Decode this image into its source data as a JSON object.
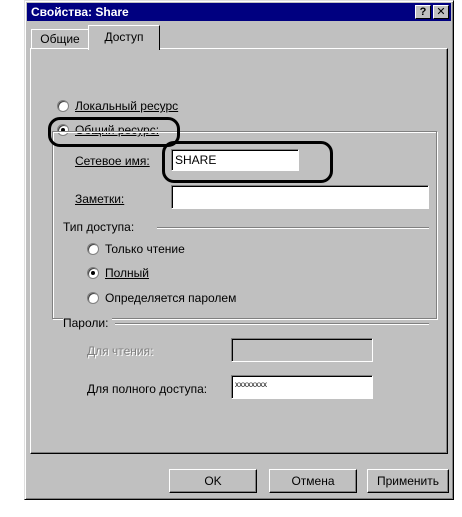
{
  "window": {
    "title": "Свойства: Share",
    "help_btn": "?",
    "close_btn": "✕"
  },
  "tabs": {
    "general": "Общие",
    "access": "Доступ"
  },
  "share_mode": {
    "local_label": "Локальный ресурс",
    "shared_label": "Общий ресурс:",
    "selected": "shared"
  },
  "share_name": {
    "label": "Сетевое имя:",
    "value": "SHARE"
  },
  "comment": {
    "label": "Заметки:",
    "value": ""
  },
  "access_type": {
    "group_label": "Тип доступа:",
    "read_only": "Только чтение",
    "full": "Полный",
    "depends": "Определяется паролем",
    "selected": "full"
  },
  "passwords": {
    "group_label": "Пароли:",
    "read_label": "Для чтения:",
    "read_value": "",
    "full_label": "Для полного доступа:",
    "full_value": "xxxxxxxx"
  },
  "buttons": {
    "ok": "OK",
    "cancel": "Отмена",
    "apply": "Применить"
  },
  "colors": {
    "titlebar": "#000080",
    "face": "#c0c0c0"
  }
}
